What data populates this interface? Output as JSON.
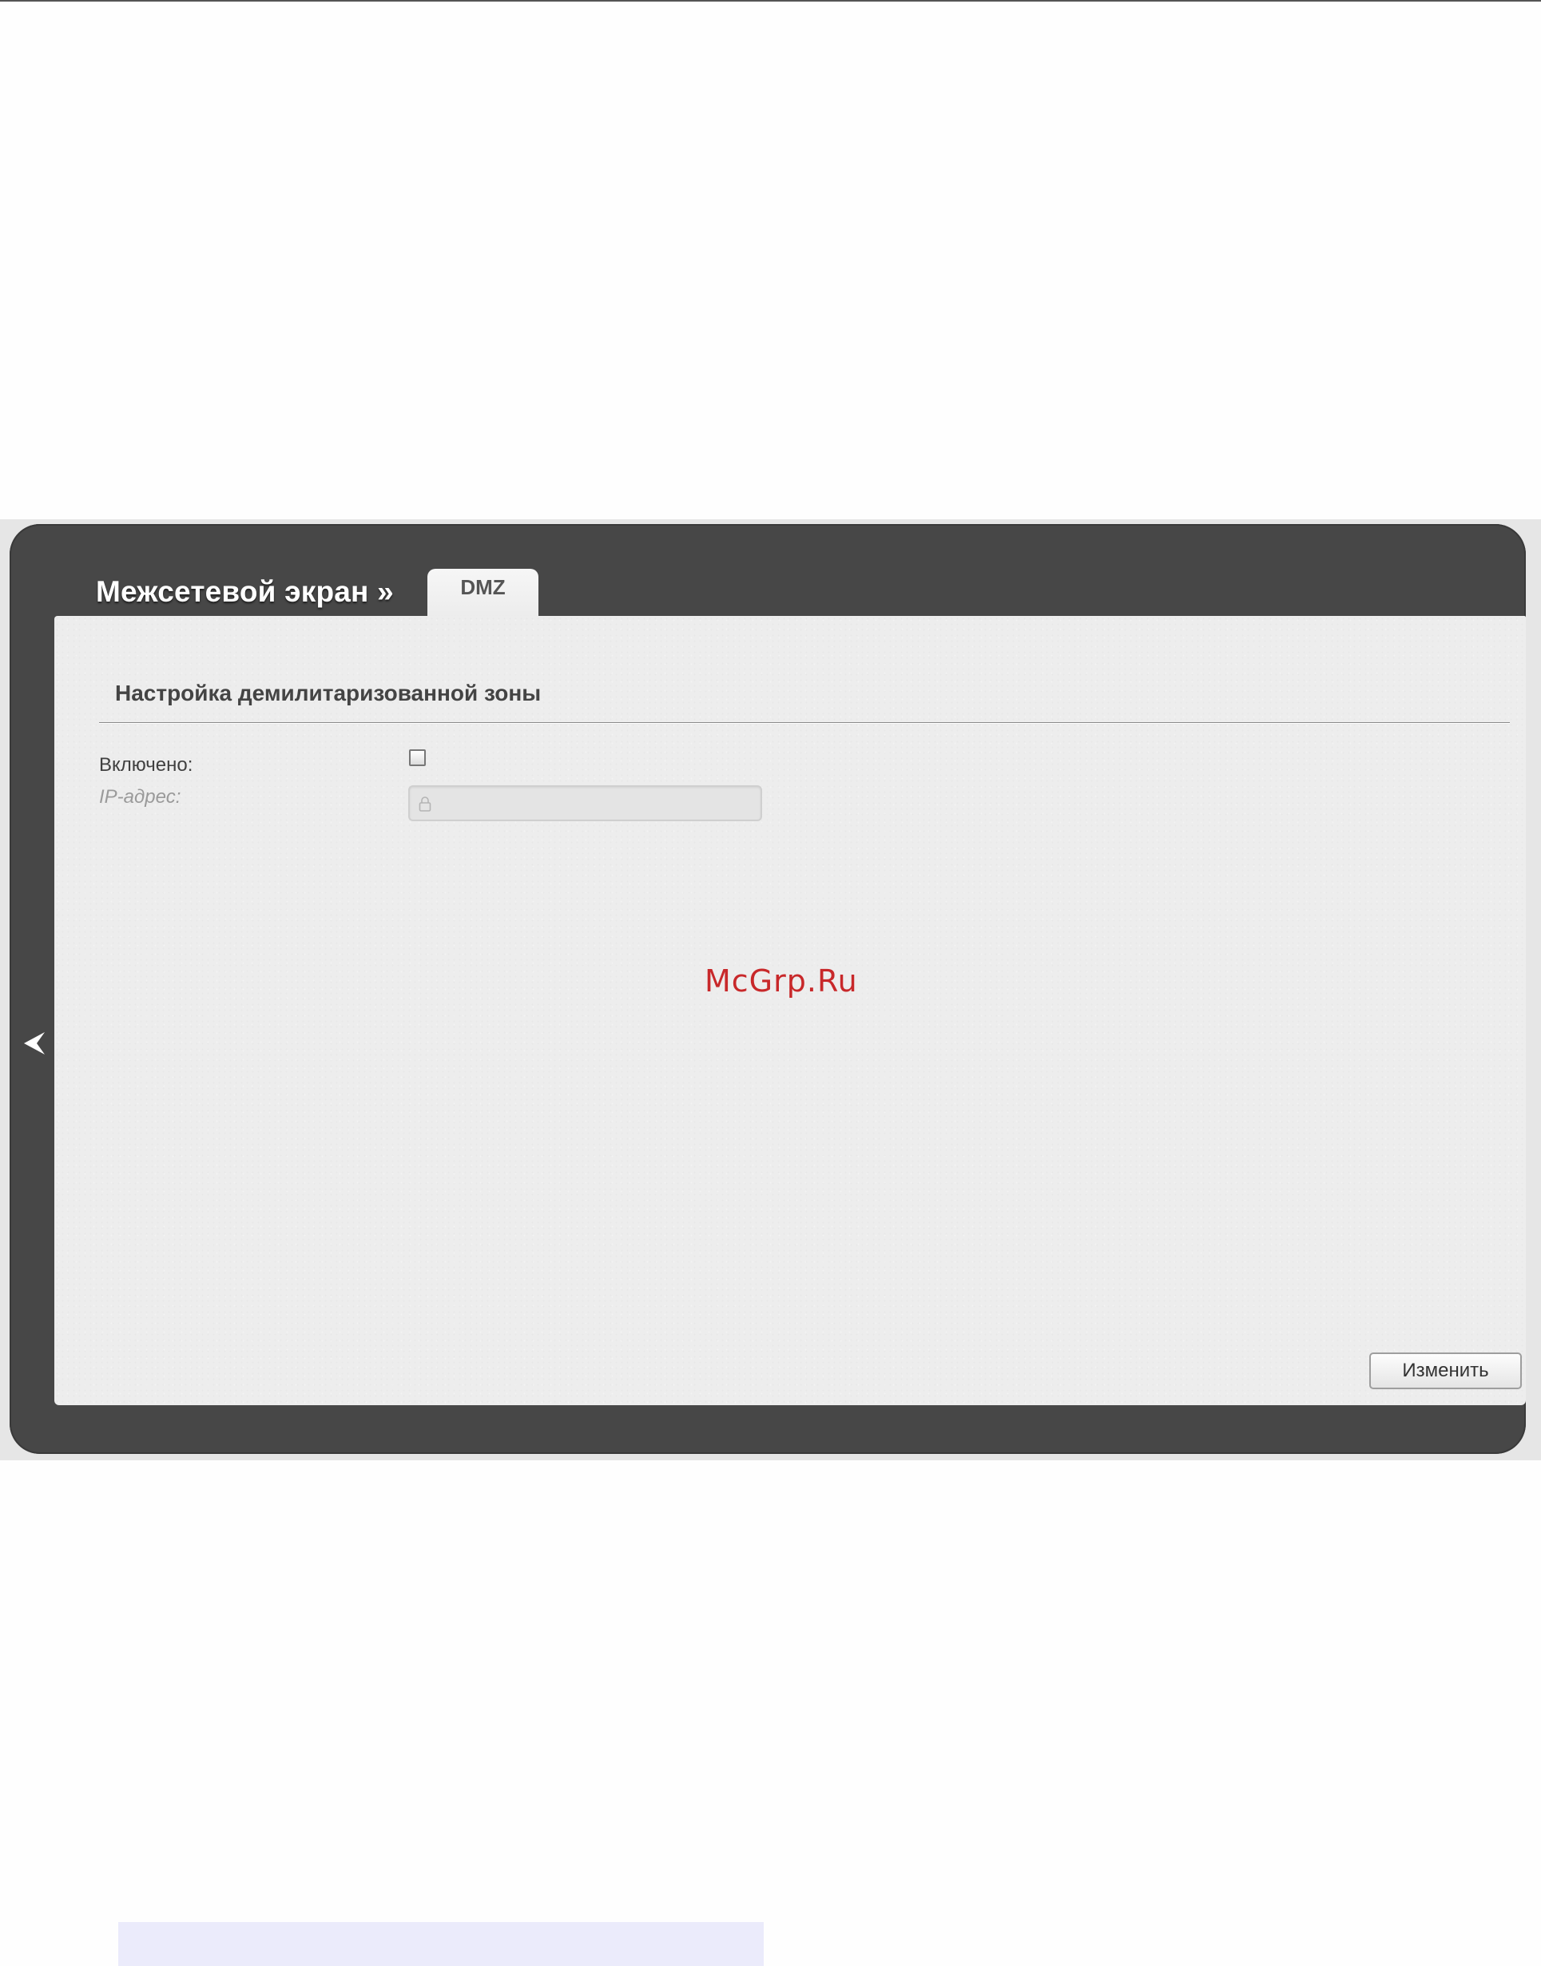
{
  "header": {
    "section_title": "Межсетевой экран »",
    "tab_label": "DMZ"
  },
  "panel": {
    "heading": "Настройка демилитаризованной зоны",
    "enabled_label": "Включено:",
    "enabled_checked": false,
    "ip_label": "IP-адрес:",
    "ip_value": "",
    "apply_label": "Изменить"
  },
  "watermark": "McGrp.Ru",
  "icons": {
    "lock": "lock-icon",
    "back": "back-arrow-icon"
  },
  "colors": {
    "frame": "#474747",
    "panel": "#ededed",
    "watermark": "#c8282a"
  }
}
